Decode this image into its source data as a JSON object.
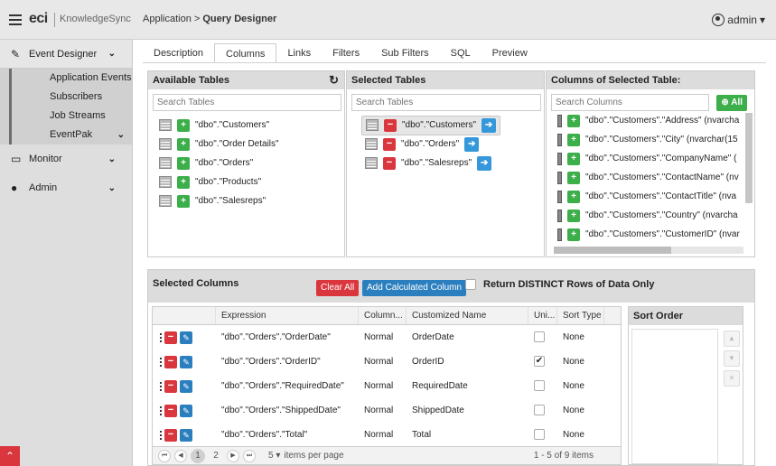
{
  "header": {
    "brand": "eci",
    "brand_sub": "KnowledgeSync",
    "breadcrumb_root": "Application",
    "breadcrumb_sep": " > ",
    "breadcrumb_current": "Query Designer",
    "user": "admin"
  },
  "sidebar": {
    "event_designer": "Event Designer",
    "sub_items": [
      "Application Events",
      "Subscribers",
      "Job Streams",
      "EventPak"
    ],
    "monitor": "Monitor",
    "admin": "Admin"
  },
  "tabs": [
    "Description",
    "Columns",
    "Links",
    "Filters",
    "Sub Filters",
    "SQL",
    "Preview"
  ],
  "active_tab": "Columns",
  "available_tables": {
    "title": "Available Tables",
    "search_placeholder": "Search Tables",
    "items": [
      "\"dbo\".\"Customers\"",
      "\"dbo\".\"Order Details\"",
      "\"dbo\".\"Orders\"",
      "\"dbo\".\"Products\"",
      "\"dbo\".\"Salesreps\""
    ]
  },
  "selected_tables": {
    "title": "Selected Tables",
    "search_placeholder": "Search Tables",
    "items": [
      "\"dbo\".\"Customers\"",
      "\"dbo\".\"Orders\"",
      "\"dbo\".\"Salesreps\""
    ]
  },
  "columns_of_selected": {
    "title": "Columns of Selected Table:",
    "search_placeholder": "Search Columns",
    "all_label": "All",
    "items": [
      "\"dbo\".\"Customers\".\"Address\" (nvarcha",
      "\"dbo\".\"Customers\".\"City\" (nvarchar(15",
      "\"dbo\".\"Customers\".\"CompanyName\" (",
      "\"dbo\".\"Customers\".\"ContactName\" (nv",
      "\"dbo\".\"Customers\".\"ContactTitle\" (nva",
      "\"dbo\".\"Customers\".\"Country\" (nvarcha",
      "\"dbo\".\"Customers\".\"CustomerID\" (nvar"
    ]
  },
  "selected_columns": {
    "title": "Selected Columns",
    "clear_all": "Clear All",
    "add_calc": "Add Calculated Column",
    "distinct_label": "Return DISTINCT Rows of Data Only",
    "headers": [
      "Expression",
      "Column...",
      "Customized Name",
      "Uni...",
      "Sort Type"
    ],
    "rows": [
      {
        "expr": "\"dbo\".\"Orders\".\"OrderDate\"",
        "type": "Normal",
        "name": "OrderDate",
        "unique": "",
        "sort": "None"
      },
      {
        "expr": "\"dbo\".\"Orders\".\"OrderID\"",
        "type": "Normal",
        "name": "OrderID",
        "unique": "✔",
        "sort": "None"
      },
      {
        "expr": "\"dbo\".\"Orders\".\"RequiredDate\"",
        "type": "Normal",
        "name": "RequiredDate",
        "unique": "",
        "sort": "None"
      },
      {
        "expr": "\"dbo\".\"Orders\".\"ShippedDate\"",
        "type": "Normal",
        "name": "ShippedDate",
        "unique": "",
        "sort": "None"
      },
      {
        "expr": "\"dbo\".\"Orders\".\"Total\"",
        "type": "Normal",
        "name": "Total",
        "unique": "",
        "sort": "None"
      }
    ],
    "pager": {
      "page1": "1",
      "page2": "2",
      "page_size": "5",
      "items_per_page": "items per page",
      "info": "1 - 5 of 9 items"
    }
  },
  "sort_order": {
    "title": "Sort Order"
  }
}
